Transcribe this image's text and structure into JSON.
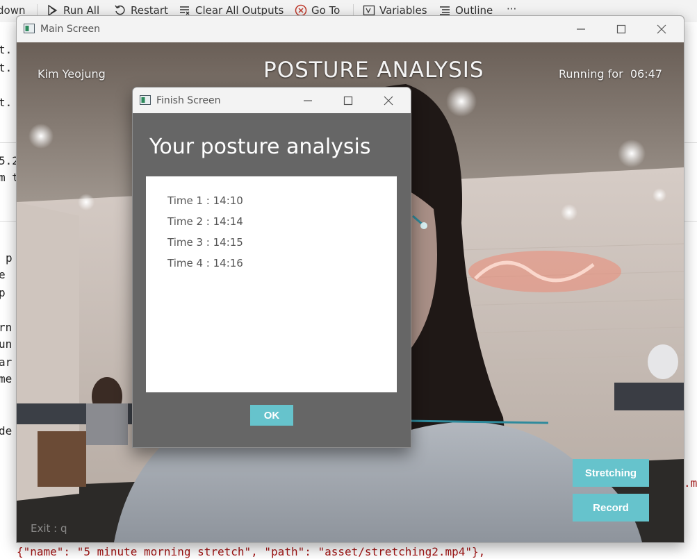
{
  "toolbar": {
    "items": [
      {
        "label": "down",
        "icon": "none"
      },
      {
        "label": "Run All",
        "icon": "run-all-icon"
      },
      {
        "label": "Restart",
        "icon": "restart-icon"
      },
      {
        "label": "Clear All Outputs",
        "icon": "clear-outputs-icon"
      },
      {
        "label": "Go To",
        "icon": "go-to-icon"
      },
      {
        "label": "Variables",
        "icon": "variables-icon"
      },
      {
        "label": "Outline",
        "icon": "outline-icon"
      }
    ],
    "more": "···"
  },
  "background_code": {
    "left_fragments": [
      "t.",
      "t.",
      "t.",
      "5.2",
      "m t",
      "p",
      "e",
      "p",
      "rn",
      "un",
      "ar",
      "me",
      "de"
    ],
    "right_fragment": ".mp",
    "bottom_line": "{\"name\": \"5 minute morning stretch\", \"path\": \"asset/stretching2.mp4\"},"
  },
  "main_window": {
    "title": "Main Screen",
    "user_name": "Kim Yeojung",
    "heading": "POSTURE ANALYSIS",
    "running_label": "Running for",
    "running_time": "06:47",
    "stretching_button": "Stretching",
    "record_button": "Record",
    "exit_hint": "Exit : q"
  },
  "finish_window": {
    "title": "Finish Screen",
    "heading": "Your posture analysis",
    "entries": [
      {
        "label": "Time 1",
        "time": "14:10"
      },
      {
        "label": "Time 2",
        "time": "14:14"
      },
      {
        "label": "Time 3",
        "time": "14:15"
      },
      {
        "label": "Time 4",
        "time": "14:16"
      }
    ],
    "ok_button": "OK"
  },
  "colors": {
    "accent_button": "#66c3cc",
    "dialog_bg": "#666666",
    "pose_line": "#2e8a9c"
  }
}
